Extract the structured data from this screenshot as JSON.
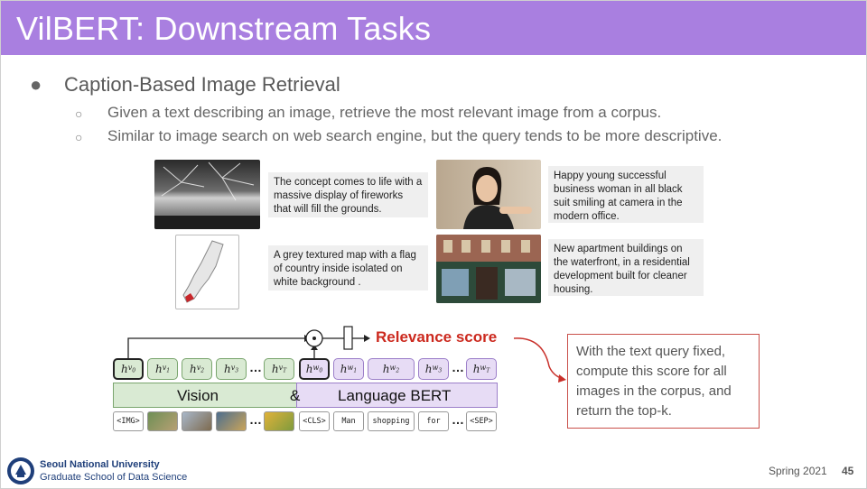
{
  "slide": {
    "title": "VilBERT: Downstream Tasks",
    "bullet": {
      "marker": "●",
      "text": "Caption-Based Image Retrieval"
    },
    "sub_bullets": [
      {
        "marker": "○",
        "text": "Given a text describing an image, retrieve the most relevant image from a corpus."
      },
      {
        "marker": "○",
        "text": "Similar to image search on web search engine, but the query tends to be more descriptive."
      }
    ]
  },
  "examples": [
    {
      "caption": "The concept comes to life with a massive display of fireworks that will fill the grounds."
    },
    {
      "caption": "A grey textured map with a flag of country inside isolated on white background ."
    },
    {
      "caption": "Happy young successful business woman in all black suit smiling at camera in the modern office."
    },
    {
      "caption": "New apartment buildings on the waterfront, in a residential development built for cleaner housing."
    }
  ],
  "diagram": {
    "relevance_label": "Relevance score",
    "model_left": "Vision",
    "model_amp": "&",
    "model_right": "Language BERT",
    "ellipsis": "…",
    "vision_inputs": {
      "first": "<IMG>"
    },
    "language_inputs": [
      "<CLS>",
      "Man",
      "shopping",
      "for",
      "<SEP>"
    ],
    "note": "With the text query fixed, compute this score for all images in the corpus, and return the top-k."
  },
  "footer": {
    "university": "Seoul National University",
    "school": "Graduate School of Data Science",
    "term": "Spring 2021",
    "page_number": "45"
  },
  "colors": {
    "header": "#a97fe0",
    "vision_token": "#d9ead3",
    "language_token": "#e7dcf5",
    "relevance": "#cc2a1f"
  }
}
